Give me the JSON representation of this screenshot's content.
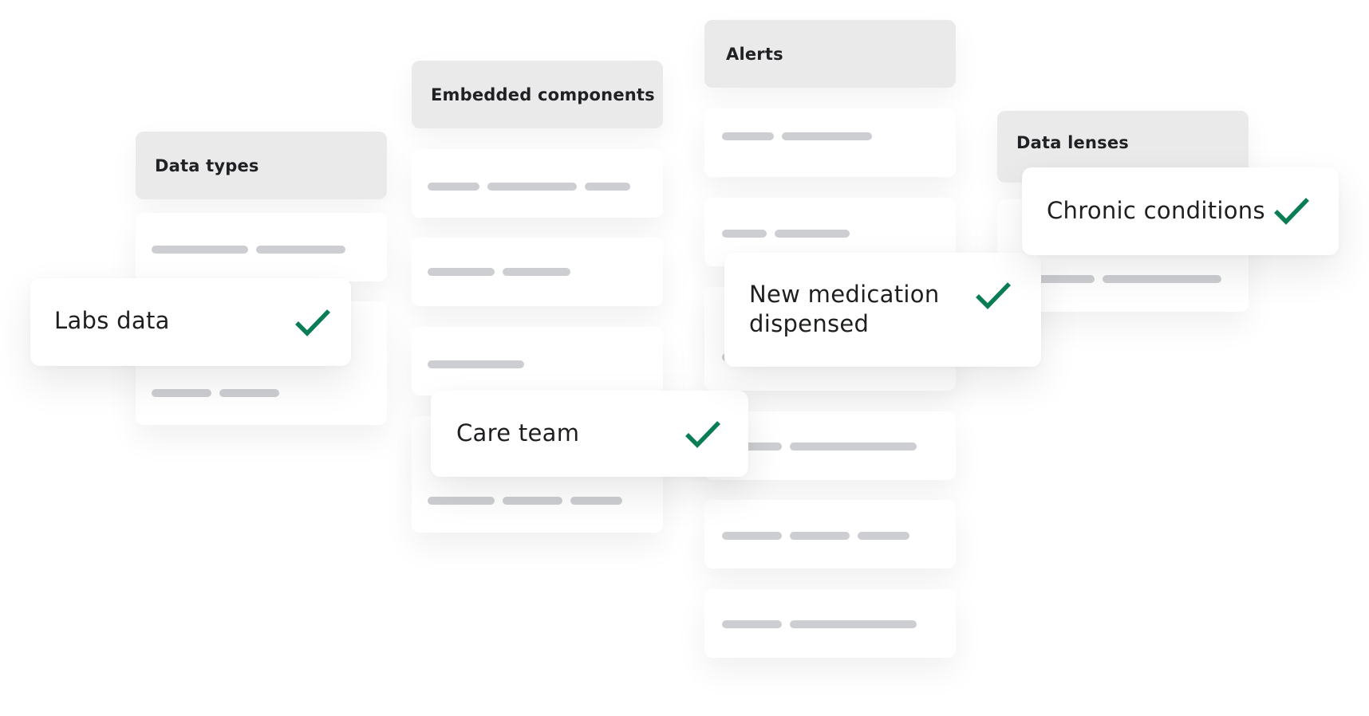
{
  "columns": [
    {
      "title": "Data types"
    },
    {
      "title": "Embedded components"
    },
    {
      "title": "Alerts"
    },
    {
      "title": "Data lenses"
    }
  ],
  "notifications": [
    {
      "label": "Labs data",
      "status": "checked",
      "icon": "check-icon"
    },
    {
      "label": "Care team",
      "status": "checked",
      "icon": "check-icon"
    },
    {
      "label": "New medication dispensed",
      "line1": "New medication",
      "line2": "dispensed",
      "status": "checked",
      "icon": "check-icon"
    },
    {
      "label": "Chronic conditions",
      "status": "checked",
      "icon": "check-icon"
    }
  ],
  "colors": {
    "check": "#0a7d55",
    "header_bg": "#eaeaeb",
    "placeholder_bar": "#cdced2",
    "text": "#1e1f21"
  }
}
